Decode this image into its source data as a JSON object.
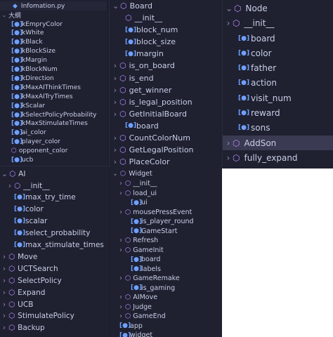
{
  "info_panel": {
    "file_name": "Infomation.py",
    "section": "大纲",
    "items": [
      {
        "kind": "field",
        "label": "kEmpryColor"
      },
      {
        "kind": "field",
        "label": "kWhite"
      },
      {
        "kind": "field",
        "label": "kBlack"
      },
      {
        "kind": "field",
        "label": "kBlockSize"
      },
      {
        "kind": "field",
        "label": "kMargin"
      },
      {
        "kind": "field",
        "label": "kBlockNum"
      },
      {
        "kind": "field",
        "label": "kDirection"
      },
      {
        "kind": "field",
        "label": "kMaxAIThinkTimes"
      },
      {
        "kind": "field",
        "label": "kMaxAITryTimes"
      },
      {
        "kind": "field",
        "label": "kScalar"
      },
      {
        "kind": "field",
        "label": "kSelectPolicyProbability"
      },
      {
        "kind": "field",
        "label": "kMaxStimulateTimes"
      },
      {
        "kind": "field",
        "label": "ai_color"
      },
      {
        "kind": "field",
        "label": "player_color"
      },
      {
        "kind": "method",
        "label": "opponent_color"
      },
      {
        "kind": "field",
        "label": "ucb"
      }
    ]
  },
  "ai_panel": {
    "title": "AI",
    "items": [
      {
        "kind": "method",
        "label": "__init__",
        "indent": 1,
        "chevron": true
      },
      {
        "kind": "field",
        "label": "max_try_time",
        "indent": 1
      },
      {
        "kind": "field",
        "label": "color",
        "indent": 1
      },
      {
        "kind": "field",
        "label": "scalar",
        "indent": 1
      },
      {
        "kind": "field",
        "label": "select_probability",
        "indent": 1
      },
      {
        "kind": "field",
        "label": "max_stimulate_times",
        "indent": 1
      },
      {
        "kind": "method",
        "label": "Move",
        "indent": 0,
        "chevron": true
      },
      {
        "kind": "method",
        "label": "UCTSearch",
        "indent": 0,
        "chevron": true
      },
      {
        "kind": "method",
        "label": "SelectPolicy",
        "indent": 0,
        "chevron": true
      },
      {
        "kind": "method",
        "label": "Expand",
        "indent": 0,
        "chevron": true
      },
      {
        "kind": "method",
        "label": "UCB",
        "indent": 0,
        "chevron": true
      },
      {
        "kind": "method",
        "label": "StimulatePolicy",
        "indent": 0,
        "chevron": true
      },
      {
        "kind": "method",
        "label": "Backup",
        "indent": 0,
        "chevron": true
      }
    ]
  },
  "board_panel": {
    "title": "Board",
    "items": [
      {
        "kind": "method",
        "label": "__init__",
        "indent": 1
      },
      {
        "kind": "field",
        "label": "block_num",
        "indent": 1
      },
      {
        "kind": "field",
        "label": "block_size",
        "indent": 1
      },
      {
        "kind": "field",
        "label": "margin",
        "indent": 1
      },
      {
        "kind": "method",
        "label": "is_on_board",
        "indent": 0,
        "chevron": true
      },
      {
        "kind": "method",
        "label": "is_end",
        "indent": 0,
        "chevron": true
      },
      {
        "kind": "method",
        "label": "get_winner",
        "indent": 0,
        "chevron": true
      },
      {
        "kind": "method",
        "label": "is_legal_position",
        "indent": 0,
        "chevron": true
      },
      {
        "kind": "method",
        "label": "GetInitialBoard",
        "indent": 0,
        "chevron": true
      },
      {
        "kind": "field",
        "label": "board",
        "indent": 1
      },
      {
        "kind": "method",
        "label": "CountColorNum",
        "indent": 0,
        "chevron": true
      },
      {
        "kind": "method",
        "label": "GetLegalPosition",
        "indent": 0,
        "chevron": true
      },
      {
        "kind": "method",
        "label": "PlaceColor",
        "indent": 0,
        "chevron": true
      }
    ]
  },
  "widget_panel": {
    "title": "Widget",
    "items": [
      {
        "kind": "method",
        "label": "__init__",
        "indent": 1,
        "chevron": true
      },
      {
        "kind": "method",
        "label": "load_ui",
        "indent": 1,
        "chevron": true
      },
      {
        "kind": "field",
        "label": "ui",
        "indent": 2
      },
      {
        "kind": "method",
        "label": "mousePressEvent",
        "indent": 1,
        "chevron": true
      },
      {
        "kind": "field",
        "label": "is_player_round",
        "indent": 2
      },
      {
        "kind": "field",
        "label": "GameStart",
        "indent": 2
      },
      {
        "kind": "method",
        "label": "Refresh",
        "indent": 1,
        "chevron": true
      },
      {
        "kind": "method",
        "label": "GameInit",
        "indent": 1,
        "chevron": true
      },
      {
        "kind": "field",
        "label": "board",
        "indent": 2
      },
      {
        "kind": "field",
        "label": "labels",
        "indent": 2
      },
      {
        "kind": "method",
        "label": "GameRemake",
        "indent": 1,
        "chevron": true
      },
      {
        "kind": "field",
        "label": "is_gaming",
        "indent": 2
      },
      {
        "kind": "method",
        "label": "AIMove",
        "indent": 1,
        "chevron": true
      },
      {
        "kind": "method",
        "label": "Judge",
        "indent": 1,
        "chevron": true
      },
      {
        "kind": "method",
        "label": "GameEnd",
        "indent": 1,
        "chevron": true
      },
      {
        "kind": "field",
        "label": "app",
        "indent": 0
      },
      {
        "kind": "field",
        "label": "widget",
        "indent": 0
      }
    ]
  },
  "node_panel": {
    "title": "Node",
    "items": [
      {
        "kind": "method",
        "label": "__init__",
        "indent": 0,
        "chevron": true
      },
      {
        "kind": "field",
        "label": "board",
        "indent": 1
      },
      {
        "kind": "field",
        "label": "color",
        "indent": 1
      },
      {
        "kind": "field",
        "label": "father",
        "indent": 1
      },
      {
        "kind": "field",
        "label": "action",
        "indent": 1
      },
      {
        "kind": "field",
        "label": "visit_num",
        "indent": 1
      },
      {
        "kind": "field",
        "label": "reward",
        "indent": 1
      },
      {
        "kind": "field",
        "label": "sons",
        "indent": 1
      },
      {
        "kind": "method",
        "label": "AddSon",
        "indent": 0,
        "chevron": true,
        "selected": true
      },
      {
        "kind": "method",
        "label": "fully_expand",
        "indent": 0,
        "chevron": true
      }
    ]
  },
  "icons": {
    "field": "field-icon",
    "method": "cube-method-icon",
    "chevron_right": "chevron-right-icon",
    "chevron_down": "chevron-down-icon"
  },
  "colors": {
    "background": "#1f2030",
    "field_icon": "#6fa0ff",
    "method_icon": "#b98cff",
    "text": "#c8cfe6",
    "selection": "#3a3a52"
  }
}
